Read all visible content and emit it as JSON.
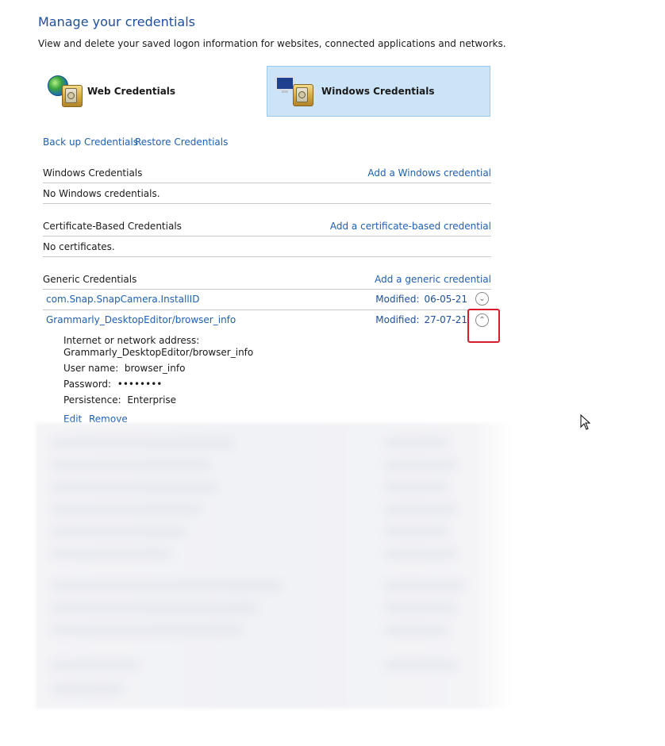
{
  "header": {
    "title": "Manage your credentials",
    "description": "View and delete your saved logon information for websites, connected applications and networks."
  },
  "tiles": {
    "web": "Web Credentials",
    "windows": "Windows Credentials"
  },
  "actions": {
    "backup": "Back up Credentials",
    "restore": "Restore Credentials"
  },
  "sections": {
    "windows": {
      "title": "Windows Credentials",
      "add": "Add a Windows credential",
      "empty": "No Windows credentials."
    },
    "certificate": {
      "title": "Certificate-Based Credentials",
      "add": "Add a certificate-based credential",
      "empty": "No certificates."
    },
    "generic": {
      "title": "Generic Credentials",
      "add": "Add a generic credential",
      "items": [
        {
          "name": "com.Snap.SnapCamera.InstallID",
          "modified_label": "Modified:",
          "modified": "06-05-21"
        },
        {
          "name": "Grammarly_DesktopEditor/browser_info",
          "modified_label": "Modified:",
          "modified": "27-07-21"
        }
      ]
    }
  },
  "details": {
    "address_label": "Internet or network address:",
    "address": "Grammarly_DesktopEditor/browser_info",
    "username_label": "User name:",
    "username": "browser_info",
    "password_label": "Password:",
    "password": "••••••••",
    "persistence_label": "Persistence:",
    "persistence": "Enterprise",
    "edit": "Edit",
    "remove": "Remove"
  },
  "icons": {
    "web_tile": "globe-vault-icon",
    "windows_tile": "monitor-vault-icon",
    "collapsed": "chevron-down-icon",
    "expanded": "chevron-up-icon",
    "cursor": "mouse-pointer-icon"
  },
  "colors": {
    "link": "#1e5fb4",
    "title": "#1e4f9c",
    "selected_tile": "#cce4f7",
    "highlight": "#d81c2c"
  }
}
